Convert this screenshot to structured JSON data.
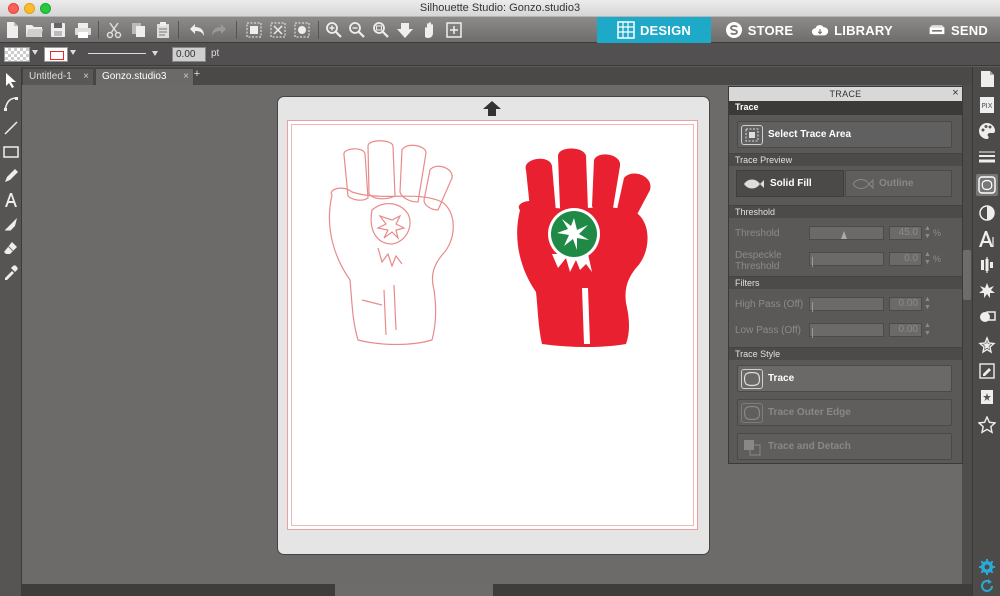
{
  "window": {
    "title": "Silhouette Studio: Gonzo.studio3"
  },
  "toolbar": {
    "icons": [
      "new-file-icon",
      "open-folder-icon",
      "save-icon",
      "print-icon",
      "cut-icon",
      "copy-icon",
      "paste-icon",
      "undo-icon",
      "redo-icon",
      "select-all-icon",
      "deselect-icon",
      "select-by-color-icon",
      "zoom-in-icon",
      "zoom-out-icon",
      "zoom-to-fit-icon",
      "move-down-icon",
      "pan-hand-icon",
      "fit-to-page-icon"
    ]
  },
  "nav_tabs": [
    {
      "label": "DESIGN",
      "icon": "grid-icon",
      "active": true
    },
    {
      "label": "STORE",
      "icon": "store-s-icon",
      "active": false
    },
    {
      "label": "LIBRARY",
      "icon": "cloud-icon",
      "active": false
    },
    {
      "label": "SEND",
      "icon": "cutter-icon",
      "active": false
    }
  ],
  "style_bar": {
    "line_width": "0.00",
    "unit": "pt"
  },
  "doc_tabs": [
    {
      "label": "Untitled-1",
      "active": false
    },
    {
      "label": "Gonzo.studio3",
      "active": true
    }
  ],
  "doc_tab_add": "+",
  "left_tools": [
    "select-arrow-icon",
    "point-edit-icon",
    "line-tool-icon",
    "rectangle-tool-icon",
    "freehand-pencil-icon",
    "text-tool-icon",
    "knife-tool-icon",
    "eraser-icon",
    "eyedropper-icon"
  ],
  "trace_panel": {
    "window_title": "TRACE",
    "close_glyph": "×",
    "header": "Trace",
    "select_area_label": "Select Trace Area",
    "preview_section": "Trace Preview",
    "solid_fill_label": "Solid Fill",
    "outline_label": "Outline",
    "threshold_section": "Threshold",
    "threshold_label": "Threshold",
    "threshold_value": "45.0",
    "threshold_unit": "%",
    "despeckle_label_1": "Despeckle",
    "despeckle_label_2": "Threshold",
    "despeckle_value": "0.0",
    "despeckle_unit": "%",
    "filters_section": "Filters",
    "high_pass_label": "High Pass (Off)",
    "high_pass_value": "0.00",
    "low_pass_label": "Low Pass (Off)",
    "low_pass_value": "0.00",
    "style_section": "Trace Style",
    "trace_btn": "Trace",
    "trace_outer_btn": "Trace Outer Edge",
    "trace_detach_btn": "Trace and Detach",
    "spin_up": "▲",
    "spin_down": "▼"
  },
  "right_strip": [
    "page-setup-icon",
    "pixscan-icon",
    "fill-palette-icon",
    "line-style-icon",
    "trace-icon",
    "transparency-icon",
    "text-style-icon",
    "align-icon",
    "replicate-icon",
    "modify-icon",
    "offset-icon",
    "sketch-icon",
    "star-favorites-icon"
  ],
  "colors": {
    "accent": "#1ea9c8",
    "fist_red": "#e8202f",
    "flower_green": "#1f8a45",
    "outline_red": "#e98a8a"
  }
}
